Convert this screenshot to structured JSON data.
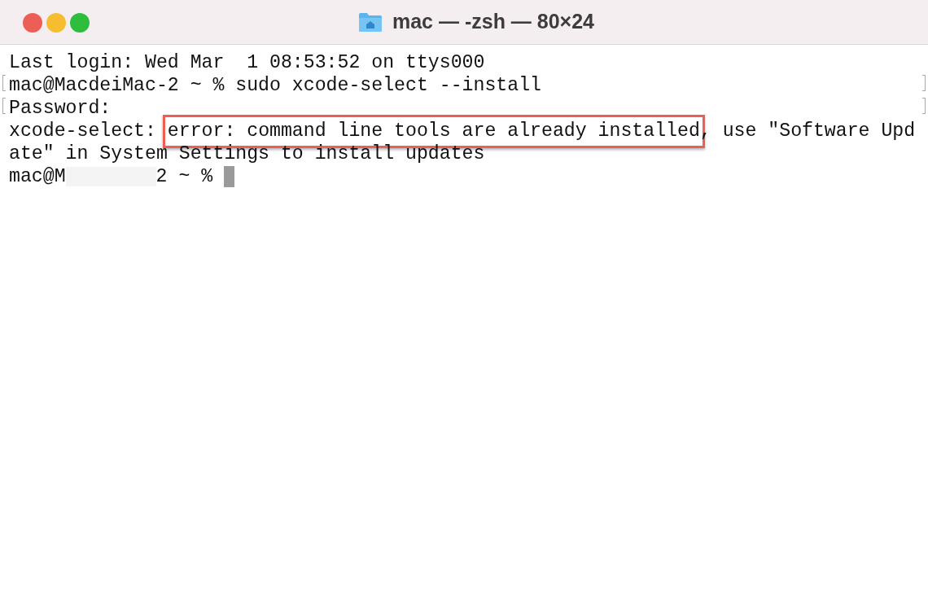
{
  "window": {
    "title": "mac — -zsh — 80×24"
  },
  "terminal": {
    "lines": [
      {
        "kind": "plain",
        "marked": false,
        "text": "Last login: Wed Mar  1 08:53:52 on ttys000"
      },
      {
        "kind": "plain",
        "marked": true,
        "text": "mac@MacdeiMac-2 ~ % sudo xcode-select --install"
      },
      {
        "kind": "plain",
        "marked": true,
        "text": "Password:"
      },
      {
        "kind": "highlight",
        "marked": false,
        "before": "xcode-select: ",
        "highlight": "error: command line tools are already installed",
        "after": ", use \"Software Upd"
      },
      {
        "kind": "plain",
        "marked": false,
        "text": "ate\" in System Settings to install updates"
      },
      {
        "kind": "prompt",
        "marked": false,
        "before": "mac@M",
        "after": "2 ~ %",
        "cursor": true
      }
    ]
  }
}
